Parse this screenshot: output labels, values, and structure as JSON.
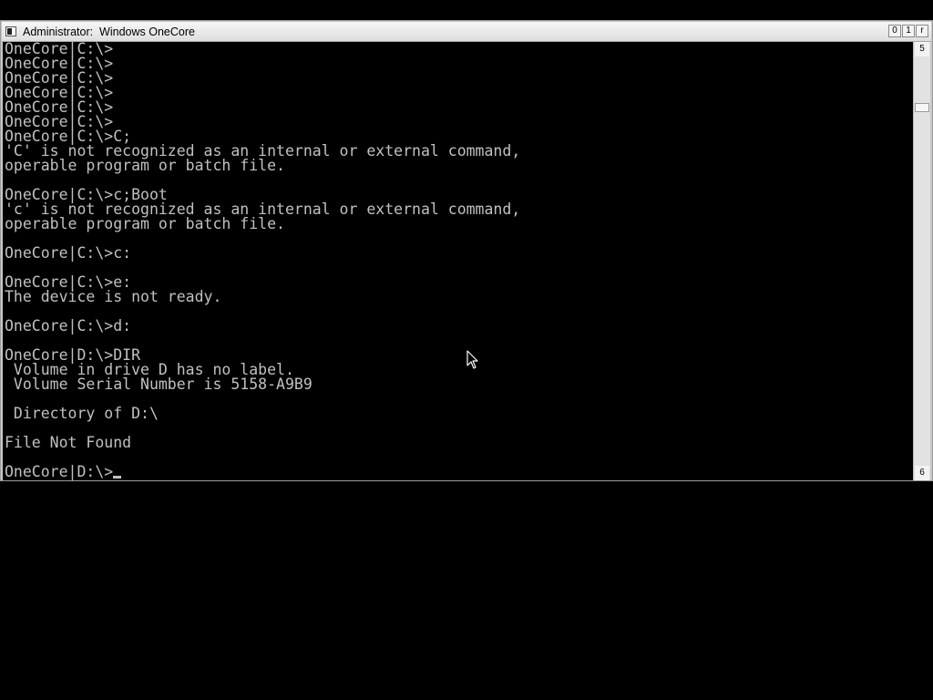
{
  "window": {
    "title": "Administrator:  Windows OneCore",
    "controls": {
      "minimize": "0",
      "maximize": "1",
      "close": "r"
    }
  },
  "scrollbar": {
    "up_glyph": "5",
    "down_glyph": "6"
  },
  "console": {
    "lines": [
      "OneCore|C:\\>",
      "OneCore|C:\\>",
      "OneCore|C:\\>",
      "OneCore|C:\\>",
      "OneCore|C:\\>",
      "OneCore|C:\\>",
      "OneCore|C:\\>C;",
      "'C' is not recognized as an internal or external command,",
      "operable program or batch file.",
      "",
      "OneCore|C:\\>c;Boot",
      "'c' is not recognized as an internal or external command,",
      "operable program or batch file.",
      "",
      "OneCore|C:\\>c:",
      "",
      "OneCore|C:\\>e:",
      "The device is not ready.",
      "",
      "OneCore|C:\\>d:",
      "",
      "OneCore|D:\\>DIR",
      " Volume in drive D has no label.",
      " Volume Serial Number is 5158-A9B9",
      "",
      " Directory of D:\\",
      "",
      "File Not Found",
      "",
      "OneCore|D:\\>"
    ]
  },
  "colors": {
    "console_bg": "#000000",
    "console_fg": "#c0c0c0",
    "titlebar_bg": "#e8e8e8"
  },
  "icons": {
    "system_menu": "console-window-icon",
    "mouse_pointer": "arrow-pointer-icon"
  }
}
